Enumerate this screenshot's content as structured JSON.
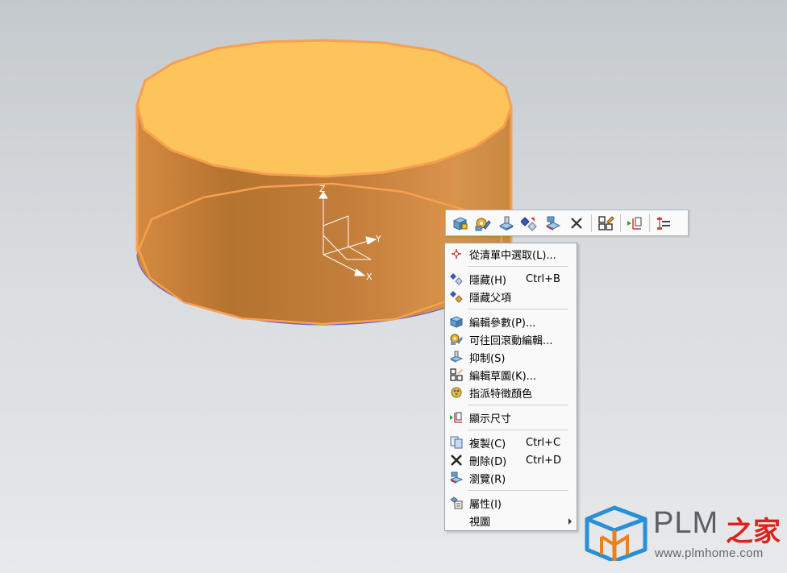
{
  "colors": {
    "cylinder_top": "#fec45c",
    "cylinder_side": "#c8803a",
    "edge_highlight": "#f7a050",
    "menu_bg": "#f9f9f9",
    "logo_red": "#d9241c"
  },
  "csys": {
    "z_label": "Z",
    "y_label": "Y",
    "x_label": "X"
  },
  "mini_toolbar": {
    "buttons": [
      {
        "icon": "edit-parameters-icon"
      },
      {
        "icon": "edit-with-rollback-icon"
      },
      {
        "icon": "suppress-icon"
      },
      {
        "icon": "hide-icon"
      },
      {
        "icon": "browse-icon"
      },
      {
        "icon": "delete-icon"
      },
      {
        "icon": "edit-sketch-icon"
      },
      {
        "icon": "show-dimensions-icon"
      },
      {
        "icon": "feature-list-icon"
      }
    ]
  },
  "context_menu": {
    "items": [
      {
        "label": "從清單中選取(L)...",
        "shortcut": "",
        "icon": "pick-from-list-icon"
      },
      {
        "label": "隱藏(H)",
        "shortcut": "Ctrl+B",
        "icon": "hide-icon"
      },
      {
        "label": "隱藏父項",
        "shortcut": "",
        "icon": "hide-parents-icon"
      },
      {
        "label": "編輯參數(P)...",
        "shortcut": "",
        "icon": "edit-parameters-icon"
      },
      {
        "label": "可往回滾動編輯...",
        "shortcut": "",
        "icon": "edit-with-rollback-icon"
      },
      {
        "label": "抑制(S)",
        "shortcut": "",
        "icon": "suppress-icon"
      },
      {
        "label": "編輯草圖(K)...",
        "shortcut": "",
        "icon": "edit-sketch-icon"
      },
      {
        "label": "指派特徵顏色",
        "shortcut": "",
        "icon": "assign-feature-color-icon"
      },
      {
        "label": "顯示尺寸",
        "shortcut": "",
        "icon": "show-dimensions-icon"
      },
      {
        "label": "複製(C)",
        "shortcut": "Ctrl+C",
        "icon": "copy-icon"
      },
      {
        "label": "刪除(D)",
        "shortcut": "Ctrl+D",
        "icon": "delete-icon"
      },
      {
        "label": "瀏覽(R)",
        "shortcut": "",
        "icon": "browse-icon"
      },
      {
        "label": "屬性(I)",
        "shortcut": "",
        "icon": "properties-icon"
      },
      {
        "label": "視圖",
        "shortcut": "",
        "icon": "",
        "has_submenu": true
      }
    ]
  },
  "watermark": {
    "brand": "PLM",
    "brand_cn": "之家",
    "url": "www.plmhome.com"
  }
}
